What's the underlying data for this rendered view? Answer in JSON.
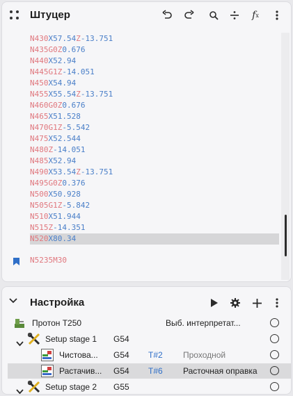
{
  "code_panel": {
    "title": "Штуцер",
    "lines": [
      [
        [
          "n",
          "N430"
        ],
        [
          "t",
          "X57.54"
        ],
        [
          "n",
          "Z"
        ],
        [
          "t",
          "-13.751"
        ]
      ],
      [
        [
          "n",
          "N435"
        ],
        [
          "n",
          "G0"
        ],
        [
          "n",
          "Z"
        ],
        [
          "t",
          "0.676"
        ]
      ],
      [
        [
          "n",
          "N440"
        ],
        [
          "t",
          "X52.94"
        ]
      ],
      [
        [
          "n",
          "N445"
        ],
        [
          "n",
          "G1"
        ],
        [
          "n",
          "Z"
        ],
        [
          "t",
          "-14.051"
        ]
      ],
      [
        [
          "n",
          "N450"
        ],
        [
          "t",
          "X54.94"
        ]
      ],
      [
        [
          "n",
          "N455"
        ],
        [
          "t",
          "X55.54"
        ],
        [
          "n",
          "Z"
        ],
        [
          "t",
          "-13.751"
        ]
      ],
      [
        [
          "n",
          "N460"
        ],
        [
          "n",
          "G0"
        ],
        [
          "n",
          "Z"
        ],
        [
          "t",
          "0.676"
        ]
      ],
      [
        [
          "n",
          "N465"
        ],
        [
          "t",
          "X51.528"
        ]
      ],
      [
        [
          "n",
          "N470"
        ],
        [
          "n",
          "G1"
        ],
        [
          "n",
          "Z"
        ],
        [
          "t",
          "-5.542"
        ]
      ],
      [
        [
          "n",
          "N475"
        ],
        [
          "t",
          "X52.544"
        ]
      ],
      [
        [
          "n",
          "N480"
        ],
        [
          "n",
          "Z"
        ],
        [
          "t",
          "-14.051"
        ]
      ],
      [
        [
          "n",
          "N485"
        ],
        [
          "t",
          "X52.94"
        ]
      ],
      [
        [
          "n",
          "N490"
        ],
        [
          "t",
          "X53.54"
        ],
        [
          "n",
          "Z"
        ],
        [
          "t",
          "-13.751"
        ]
      ],
      [
        [
          "n",
          "N495"
        ],
        [
          "n",
          "G0"
        ],
        [
          "n",
          "Z"
        ],
        [
          "t",
          "0.376"
        ]
      ],
      [
        [
          "n",
          "N500"
        ],
        [
          "t",
          "X50.928"
        ]
      ],
      [
        [
          "n",
          "N505"
        ],
        [
          "n",
          "G1"
        ],
        [
          "n",
          "Z"
        ],
        [
          "t",
          "-5.842"
        ]
      ],
      [
        [
          "n",
          "N510"
        ],
        [
          "t",
          "X51.944"
        ]
      ],
      [
        [
          "n",
          "N515"
        ],
        [
          "n",
          "Z"
        ],
        [
          "t",
          "-14.351"
        ]
      ],
      [
        [
          "n",
          "N520"
        ],
        [
          "t",
          "X80.34"
        ]
      ]
    ],
    "selected_line": 18,
    "program_line": [
      [
        "n",
        "N5235"
      ],
      [
        "n",
        "M30"
      ]
    ]
  },
  "setup_panel": {
    "title": "Настройка",
    "machine": {
      "name": "Протон Т250",
      "interpreter": "Выб. интерпретат..."
    },
    "stage1": {
      "name": "Setup stage 1",
      "cs": "G54"
    },
    "ops": [
      {
        "name": "Чистова...",
        "cs": "G54",
        "tool": "T#2",
        "tool_name": "Проходной",
        "selected": false
      },
      {
        "name": "Растачив...",
        "cs": "G54",
        "tool": "T#6",
        "tool_name": "Расточная оправка",
        "selected": true
      }
    ],
    "stage2": {
      "name": "Setup stage 2",
      "cs": "G55"
    }
  }
}
